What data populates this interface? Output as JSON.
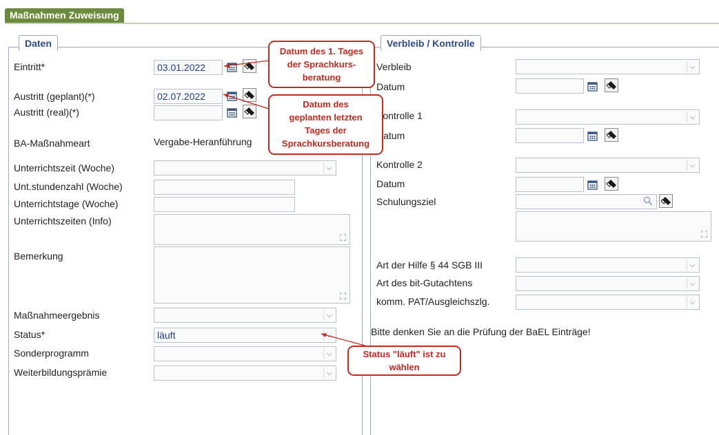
{
  "tab": {
    "label": "Maßnahmen Zuweisung"
  },
  "left_panel": {
    "legend": "Daten",
    "eintritt": {
      "label": "Eintritt*",
      "value": "03.01.2022"
    },
    "austritt_geplant": {
      "label": "Austritt (geplant)(*)",
      "value": "02.07.2022"
    },
    "austritt_real": {
      "label": "Austritt (real)(*)",
      "value": ""
    },
    "ba_massnahmeart": {
      "label": "BA-Maßnahmeart",
      "value": "Vergabe-Heranführung"
    },
    "unterrichtszeit": {
      "label": "Unterrichtszeit (Woche)",
      "value": ""
    },
    "unt_stundenzahl": {
      "label": "Unt.stundenzahl (Woche)",
      "value": ""
    },
    "unterrichtstage": {
      "label": "Unterrichtstage (Woche)",
      "value": ""
    },
    "unterrichtszeiten_info": {
      "label": "Unterrichtszeiten (Info)",
      "value": ""
    },
    "bemerkung": {
      "label": "Bemerkung",
      "value": ""
    },
    "massnahmeergebnis": {
      "label": "Maßnahmeergebnis",
      "value": ""
    },
    "status": {
      "label": "Status*",
      "value": "läuft"
    },
    "sonderprogramm": {
      "label": "Sonderprogramm",
      "value": ""
    },
    "weiterbildungspraemie": {
      "label": "Weiterbildungsprämie",
      "value": ""
    }
  },
  "right_panel": {
    "legend": "Verbleib / Kontrolle",
    "verbleib": {
      "label": "Verbleib",
      "value": ""
    },
    "datum1": {
      "label": "Datum",
      "value": ""
    },
    "kontrolle1": {
      "label": "Kontrolle 1",
      "value": ""
    },
    "datum2": {
      "label": "Datum",
      "value": ""
    },
    "kontrolle2": {
      "label": "Kontrolle 2",
      "value": ""
    },
    "datum3": {
      "label": "Datum",
      "value": ""
    },
    "schulungsziel": {
      "label": "Schulungsziel",
      "value": ""
    },
    "art_der_hilfe": {
      "label": "Art der Hilfe § 44 SGB III",
      "value": ""
    },
    "art_bit_gutachten": {
      "label": "Art des bit-Gutachtens",
      "value": ""
    },
    "komm_pat": {
      "label": "komm. PAT/Ausgleichszlg.",
      "value": ""
    },
    "hint": "Bitte denken Sie an die Prüfung der BaEL Einträge!"
  },
  "callouts": {
    "eintritt": [
      "Datum des 1. Tages",
      "der Sprachkurs-",
      "beratung"
    ],
    "austritt": [
      "Datum des",
      "geplanten letzten",
      "Tages der",
      "Sprachkursberatung"
    ],
    "status": [
      "Status \"läuft\" ist zu",
      "wählen"
    ]
  },
  "colors": {
    "tab_bg": "#6b8a3c",
    "legend_text": "#2c4a8c",
    "callout_red": "#c4281f",
    "field_text": "#1f3f8c"
  }
}
